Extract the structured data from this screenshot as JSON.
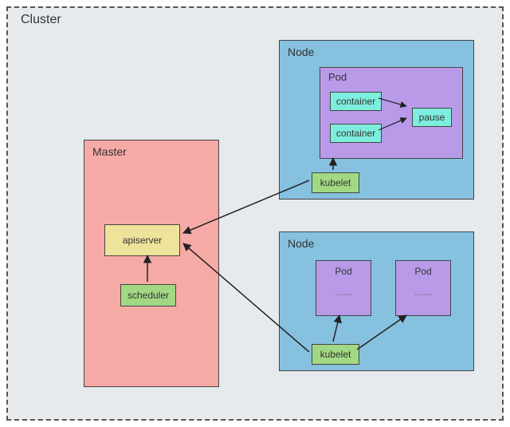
{
  "cluster": {
    "label": "Cluster"
  },
  "master": {
    "label": "Master",
    "apiserver": "apiserver",
    "scheduler": "scheduler"
  },
  "node1": {
    "label": "Node",
    "kubelet": "kubelet",
    "pod": {
      "label": "Pod",
      "container1": "container",
      "container2": "container",
      "pause": "pause"
    }
  },
  "node2": {
    "label": "Node",
    "kubelet": "kubelet",
    "pod1": {
      "label": "Pod",
      "dots": "……"
    },
    "pod2": {
      "label": "Pod",
      "dots": "……"
    }
  }
}
